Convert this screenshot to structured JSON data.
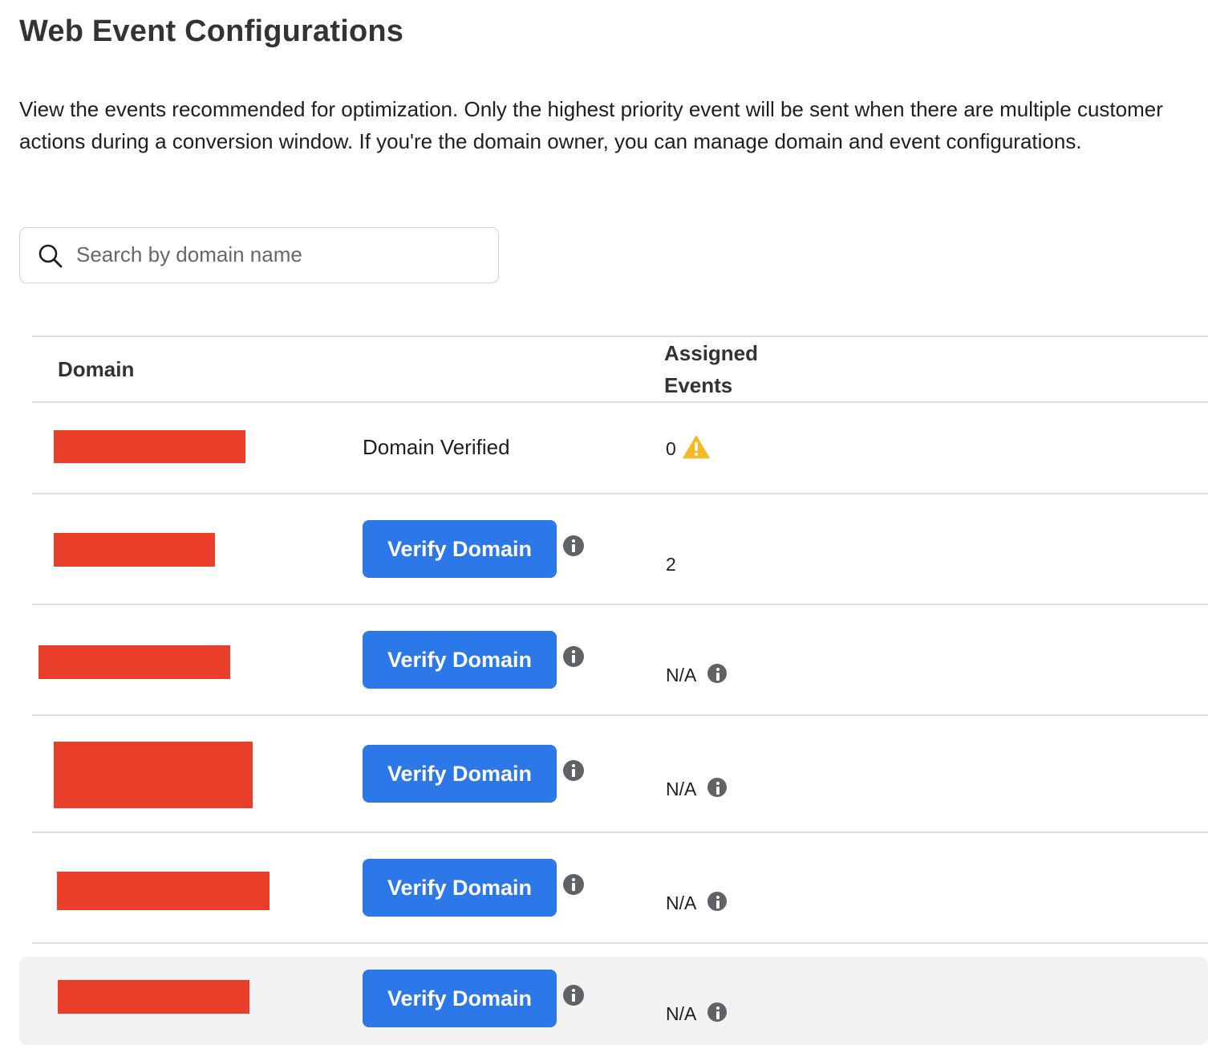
{
  "page": {
    "title": "Web Event Configurations",
    "description": "View the events recommended for optimization. Only the highest priority event will be sent when there are multiple customer actions during a conversion window. If you're the domain owner, you can manage domain and event configurations."
  },
  "search": {
    "placeholder": "Search by domain name",
    "value": "",
    "icon": "search-icon"
  },
  "table": {
    "columns": {
      "domain": "Domain",
      "assigned_events": "Assigned\nEvents"
    },
    "rows": [
      {
        "status": "Domain Verified",
        "assigned_events": "0",
        "assigned_icon": "warning-icon",
        "domain_redacted": true
      },
      {
        "action_label": "Verify Domain",
        "assigned_events": "2",
        "domain_redacted": true
      },
      {
        "action_label": "Verify Domain",
        "assigned_events": "N/A",
        "assigned_icon": "info-icon",
        "domain_redacted": true
      },
      {
        "action_label": "Verify Domain",
        "assigned_events": "N/A",
        "assigned_icon": "info-icon",
        "domain_redacted": true
      },
      {
        "action_label": "Verify Domain",
        "assigned_events": "N/A",
        "assigned_icon": "info-icon",
        "domain_redacted": true
      },
      {
        "action_label": "Verify Domain",
        "assigned_events": "N/A",
        "assigned_icon": "info-icon",
        "domain_redacted": true,
        "highlighted": true
      }
    ]
  },
  "colors": {
    "primary_button": "#2d78e8",
    "redaction": "#e93f2a",
    "warning": "#f7b928",
    "info_icon": "#5f6368",
    "divider": "#dadde1",
    "row_hover": "#f2f2f2"
  }
}
